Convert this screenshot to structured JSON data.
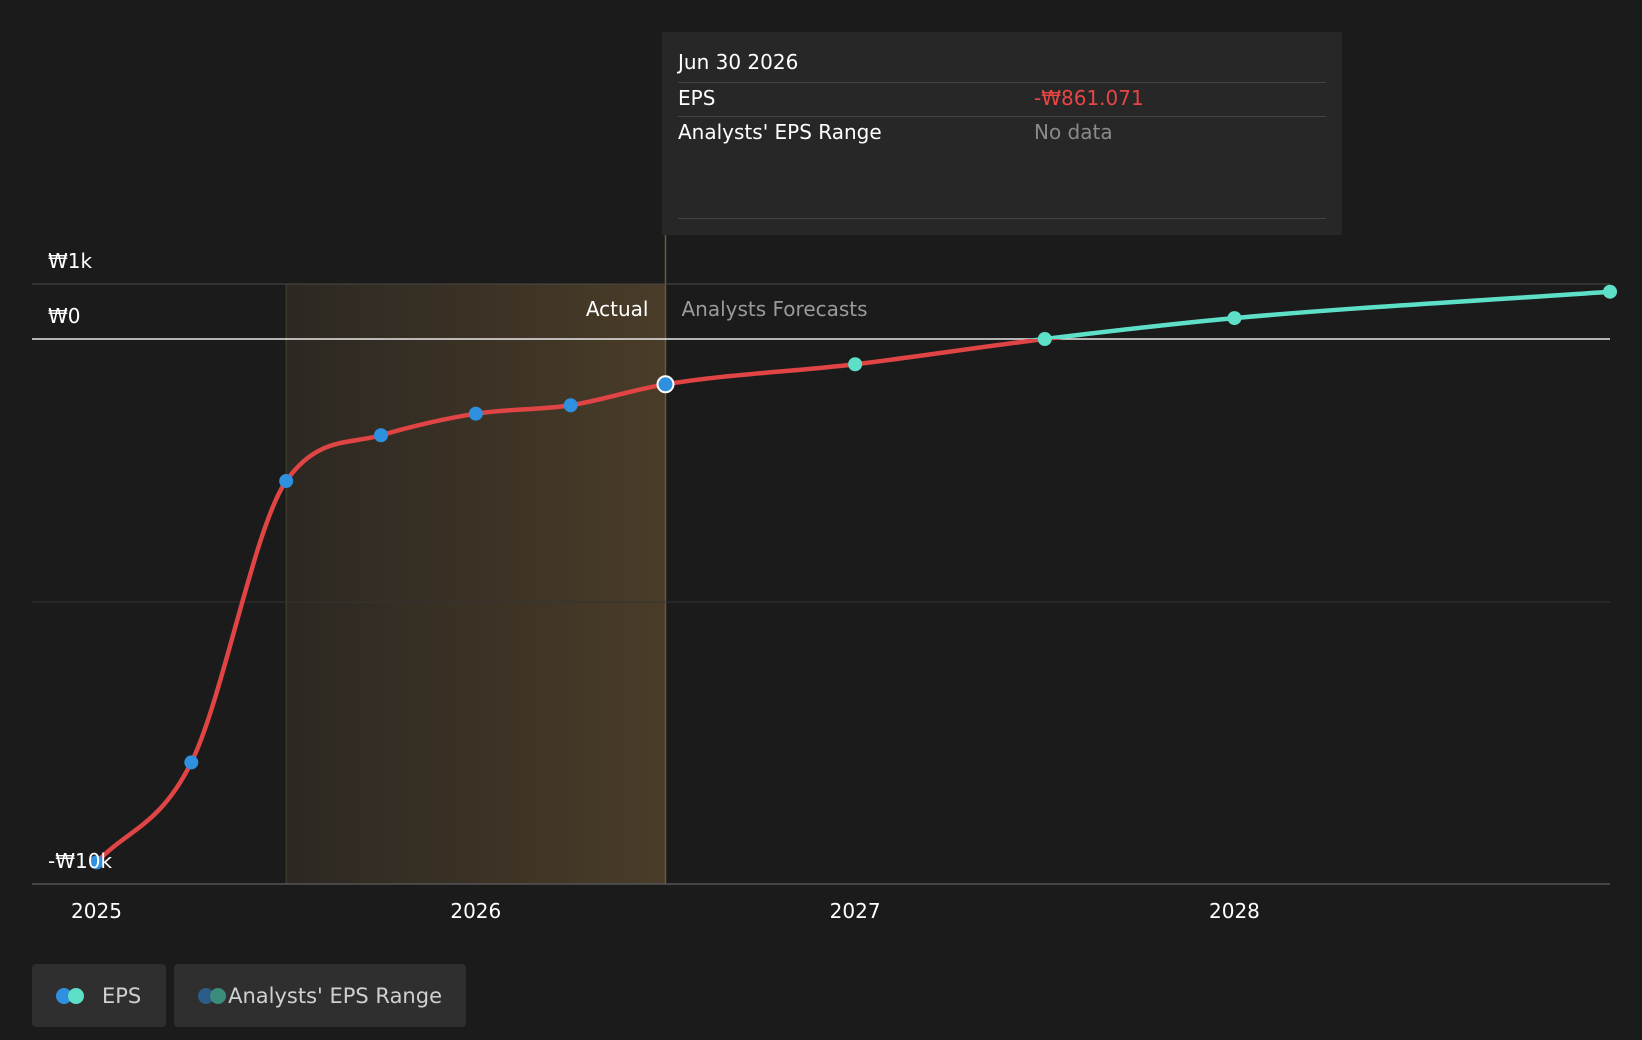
{
  "chart_data": {
    "type": "line",
    "title": "",
    "xlabel": "",
    "ylabel": "",
    "x_ticks": [
      "2025",
      "2026",
      "2027",
      "2028"
    ],
    "y_ticks": [
      {
        "label": "₩1k",
        "value": 1000
      },
      {
        "label": "₩0",
        "value": 0
      },
      {
        "label": "-₩10k",
        "value": -10000
      }
    ],
    "xlim": [
      2024.83,
      2028.99
    ],
    "ylim": [
      -10400,
      1000
    ],
    "grid": true,
    "legend_position": "bottom-left",
    "series": [
      {
        "name": "EPS",
        "segment": "actual",
        "color": "#e04444",
        "marker_color": "#2e90df",
        "points": [
          {
            "x": 2025.0,
            "y": -9950
          },
          {
            "x": 2025.25,
            "y": -8050
          },
          {
            "x": 2025.5,
            "y": -2700
          },
          {
            "x": 2025.75,
            "y": -1830
          },
          {
            "x": 2026.0,
            "y": -1420
          },
          {
            "x": 2026.25,
            "y": -1260
          },
          {
            "x": 2026.5,
            "y": -861.071
          }
        ]
      },
      {
        "name": "EPS",
        "segment": "forecast",
        "color": "#e04444",
        "marker_color": "#5ee0c8",
        "points": [
          {
            "x": 2026.5,
            "y": -861.071
          },
          {
            "x": 2027.0,
            "y": -480
          },
          {
            "x": 2027.5,
            "y": 0
          },
          {
            "x": 2028.0,
            "y": 380
          },
          {
            "x": 2028.99,
            "y": 860
          }
        ]
      }
    ],
    "highlight_region": {
      "from": 2025.5,
      "to": 2026.5
    },
    "actual_label": "Actual",
    "forecast_label": "Analysts Forecasts",
    "selected_x": 2026.5
  },
  "tooltip": {
    "date": "Jun 30 2026",
    "rows": [
      {
        "label": "EPS",
        "value": "-₩861.071",
        "color": "#e84545"
      },
      {
        "label": "Analysts' EPS Range",
        "value": "No data",
        "color": "#8a8a8a"
      }
    ]
  },
  "legend": {
    "items": [
      {
        "label": "EPS",
        "dot_colors": [
          "#2e90df",
          "#5ee0c8"
        ]
      },
      {
        "label": "Analysts' EPS Range",
        "dot_colors": [
          "#2a5d87",
          "#3c8c7d"
        ]
      }
    ]
  },
  "colors": {
    "background": "#1b1b1b",
    "forecast_positive": "#5ee0c8",
    "actual_marker": "#2e90df",
    "band_start": "#2c2822",
    "band_end": "#4a3c28"
  }
}
